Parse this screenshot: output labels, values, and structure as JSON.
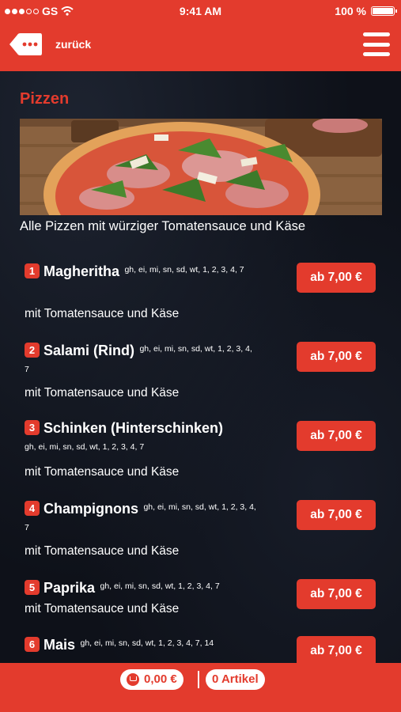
{
  "status_bar": {
    "carrier": "GS",
    "time": "9:41 AM",
    "battery": "100 %",
    "battery_level": 1.0
  },
  "header": {
    "back_label": "zurück"
  },
  "category": {
    "title": "Pizzen",
    "description": "Alle Pizzen mit würziger Tomatensauce und Käse"
  },
  "items": [
    {
      "number": "1",
      "name": "Magheritha",
      "allergens": "gh, ei, mi, sn, sd, wt, 1, 2, 3, 4, 7",
      "description": "mit Tomatensauce und Käse",
      "price": "ab 7,00 €"
    },
    {
      "number": "2",
      "name": "Salami (Rind)",
      "allergens": "gh, ei, mi, sn, sd, wt, 1, 2, 3, 4, 7",
      "description": "mit Tomatensauce und Käse",
      "price": "ab 7,00 €"
    },
    {
      "number": "3",
      "name": "Schinken (Hinterschinken)",
      "allergens": "gh, ei, mi, sn, sd, wt, 1, 2, 3, 4, 7",
      "description": "mit Tomatensauce und Käse",
      "price": "ab 7,00 €"
    },
    {
      "number": "4",
      "name": "Champignons",
      "allergens": "gh, ei, mi, sn, sd, wt, 1, 2, 3, 4, 7",
      "description": "mit Tomatensauce und Käse",
      "price": "ab 7,00 €"
    },
    {
      "number": "5",
      "name": "Paprika",
      "allergens": "gh, ei, mi, sn, sd, wt, 1, 2, 3, 4, 7",
      "description": "mit Tomatensauce und Käse",
      "price": "ab 7,00 €"
    },
    {
      "number": "6",
      "name": "Mais",
      "allergens": "gh, ei, mi, sn, sd, wt, 1, 2, 3, 4, 7, 14",
      "description": "",
      "price": "ab 7,00 €"
    }
  ],
  "footer": {
    "total": "0,00 €",
    "separator": "|",
    "cart_count": "0 Artikel"
  },
  "colors": {
    "brand": "#e33b2d",
    "background": "#0e1119",
    "text": "#ffffff"
  },
  "icons": {
    "back": "back-bubble-icon",
    "menu": "hamburger-menu-icon",
    "cart": "cart-icon",
    "wifi": "wifi-icon",
    "battery": "battery-icon"
  }
}
